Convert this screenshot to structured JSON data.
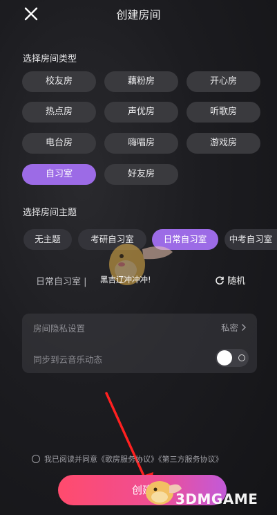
{
  "header": {
    "title": "创建房间"
  },
  "room_type": {
    "label": "选择房间类型",
    "items": [
      "校友房",
      "藕粉房",
      "开心房",
      "热点房",
      "声优房",
      "听歌房",
      "电台房",
      "嗨唱房",
      "游戏房",
      "自习室",
      "好友房"
    ],
    "selected": "自习室"
  },
  "room_theme": {
    "label": "选择房间主题",
    "items": [
      "无主题",
      "考研自习室",
      "日常自习室",
      "中考自习室"
    ],
    "selected": "日常自习室"
  },
  "room_name": {
    "prefix": "日常自习室 |",
    "value": "黑吉辽冲冲冲!",
    "random_label": "随机"
  },
  "settings": {
    "privacy_label": "房间隐私设置",
    "privacy_value": "私密",
    "sync_label": "同步到云音乐动态"
  },
  "agreement": {
    "text": "我已阅读并同意《歌房服务协议》《第三方服务协议》"
  },
  "create_button": "创建",
  "watermark": "3DMGAME",
  "colors": {
    "accent": "#9c6be6",
    "button_start": "#ff4b6d",
    "button_end": "#c25ad9"
  }
}
